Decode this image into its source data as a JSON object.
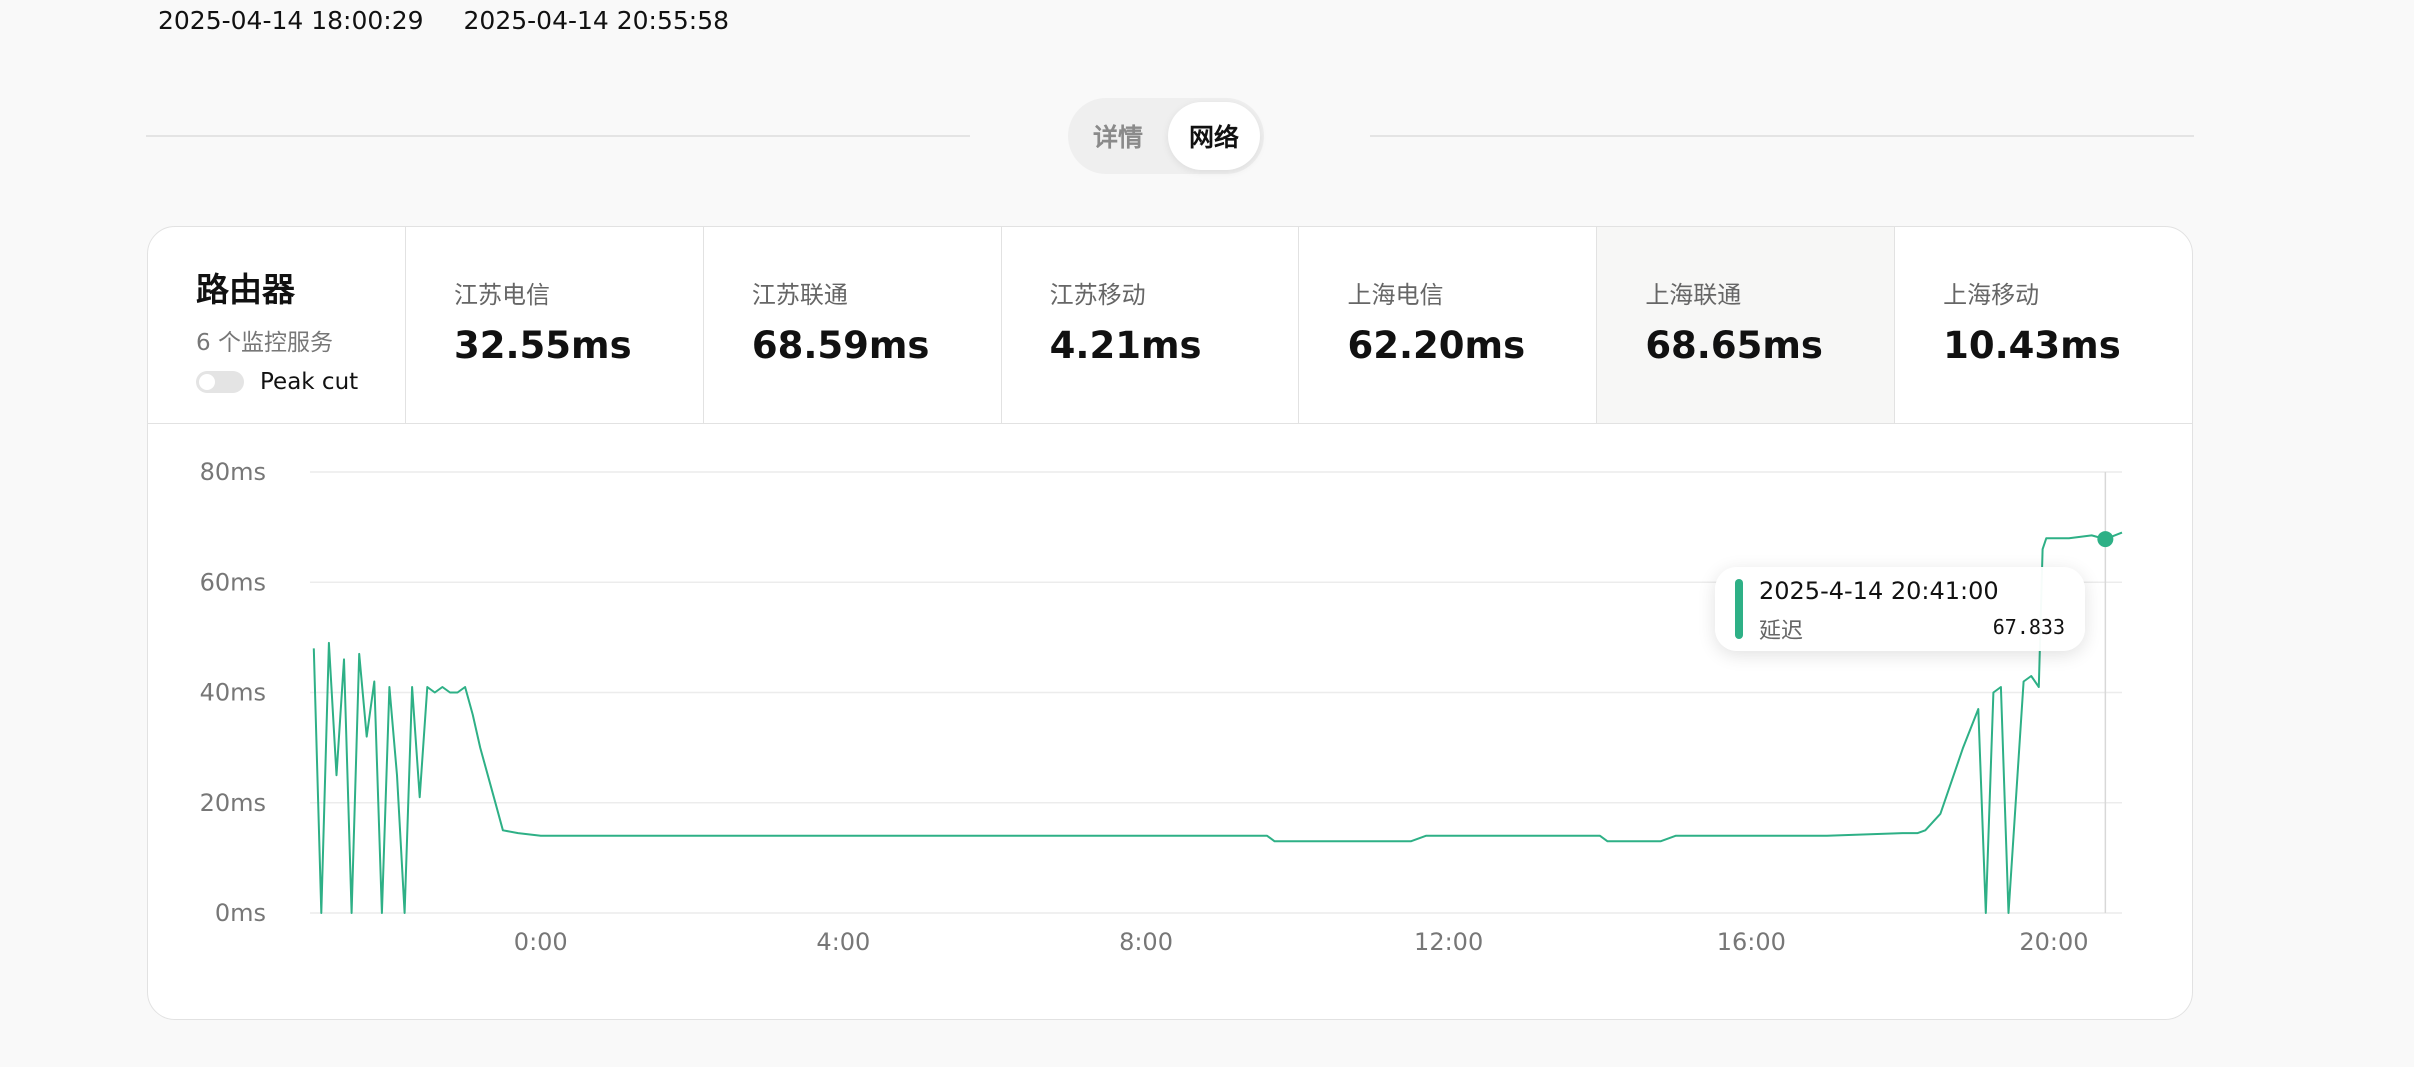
{
  "header": {
    "start_time": "2025-04-14 18:00:29",
    "end_time": "2025-04-14 20:55:58"
  },
  "tabs": [
    {
      "label": "详情",
      "active": false
    },
    {
      "label": "网络",
      "active": true
    }
  ],
  "server": {
    "name": "路由器",
    "subtitle": "6 个监控服务",
    "peak_cut_label": "Peak cut",
    "peak_cut_enabled": false
  },
  "stats": [
    {
      "name": "江苏电信",
      "value": "32.55ms"
    },
    {
      "name": "江苏联通",
      "value": "68.59ms"
    },
    {
      "name": "江苏移动",
      "value": "4.21ms"
    },
    {
      "name": "上海电信",
      "value": "62.20ms"
    },
    {
      "name": "上海联通",
      "value": "68.65ms"
    },
    {
      "name": "上海移动",
      "value": "10.43ms"
    }
  ],
  "tooltip": {
    "time": "2025-4-14 20:41:00",
    "label": "延迟",
    "value": "67.833"
  },
  "colors": {
    "accent": "#2eb086",
    "grid": "#ececec",
    "axis_text": "#777777"
  },
  "chart_data": {
    "type": "line",
    "title": "",
    "xlabel": "",
    "ylabel": "",
    "y_ticks": [
      "80ms",
      "60ms",
      "40ms",
      "20ms",
      "0ms"
    ],
    "y_tick_values": [
      80,
      60,
      40,
      20,
      0
    ],
    "x_ticks": [
      "0:00",
      "4:00",
      "8:00",
      "12:00",
      "16:00",
      "20:00"
    ],
    "x_tick_values": [
      0,
      4,
      8,
      12,
      16,
      20
    ],
    "xlim": [
      -3.05,
      20.9
    ],
    "ylim": [
      0,
      80
    ],
    "grid": true,
    "series": [
      {
        "x": [
          -3.0,
          -2.9,
          -2.8,
          -2.7,
          -2.6,
          -2.5,
          -2.4,
          -2.3,
          -2.2,
          -2.1,
          -2.0,
          -1.9,
          -1.8,
          -1.7,
          -1.6,
          -1.5,
          -1.4,
          -1.3,
          -1.2,
          -1.1,
          -1.0,
          -0.9,
          -0.8,
          -0.7,
          -0.6,
          -0.5,
          -0.3,
          0.0,
          1.0,
          2.0,
          3.0,
          4.0,
          5.0,
          6.0,
          7.0,
          8.0,
          9.0,
          9.6,
          9.7,
          10.5,
          11.5,
          11.7,
          12.5,
          13.5,
          14.0,
          14.1,
          14.8,
          15.0,
          16.0,
          17.0,
          18.0,
          18.2,
          18.3,
          18.5,
          18.6,
          18.8,
          19.0,
          19.1,
          19.2,
          19.3,
          19.4,
          19.6,
          19.7,
          19.8,
          19.85,
          19.9,
          20.0,
          20.2,
          20.5,
          20.68,
          20.9
        ],
        "y": [
          48,
          0,
          49,
          25,
          46,
          0,
          47,
          32,
          42,
          0,
          41,
          25,
          0,
          41,
          21,
          41,
          40,
          41,
          40,
          40,
          41,
          36,
          30,
          25,
          20,
          15,
          14.5,
          14,
          14,
          14,
          14,
          14,
          14,
          14,
          14,
          14,
          14,
          14,
          13,
          13,
          13,
          14,
          14,
          14,
          14,
          13,
          13,
          14,
          14,
          14,
          14.5,
          14.5,
          15,
          18,
          22,
          30,
          37,
          0,
          40,
          41,
          0,
          42,
          43,
          41,
          66,
          68,
          68,
          68,
          68.5,
          67.833,
          69
        ]
      }
    ]
  }
}
